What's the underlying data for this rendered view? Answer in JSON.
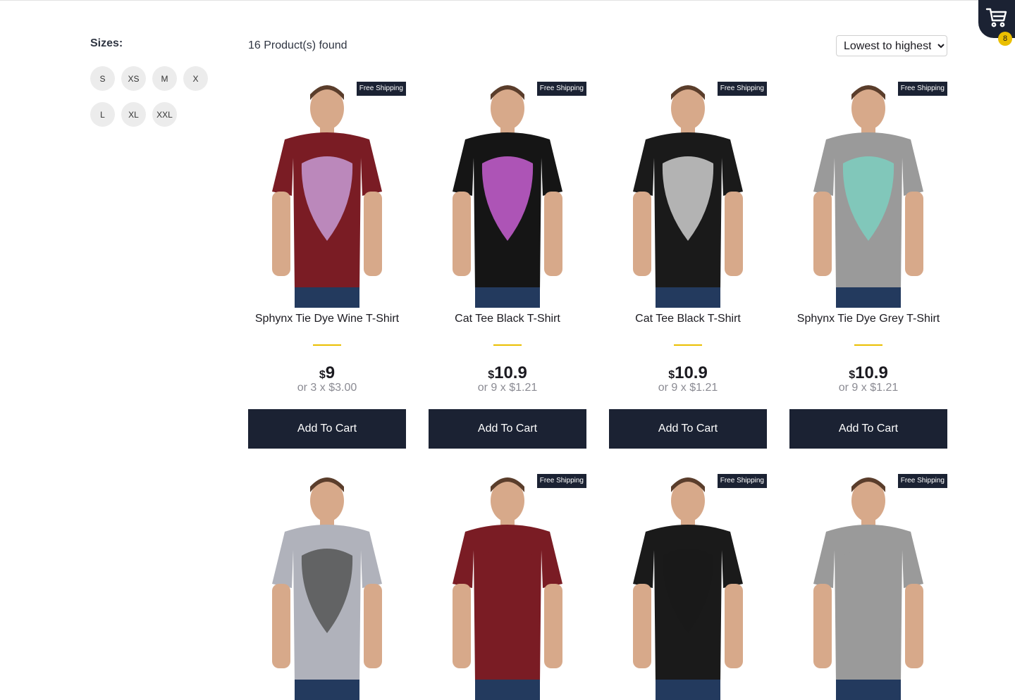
{
  "sidebar": {
    "title": "Sizes:",
    "sizes": [
      "S",
      "XS",
      "M",
      "X",
      "L",
      "XL",
      "XXL"
    ]
  },
  "header": {
    "found": "16 Product(s) found",
    "sort_selected": "Lowest to highest"
  },
  "cart": {
    "count": "8",
    "icon": "cart-icon"
  },
  "products": [
    {
      "title": "Sphynx Tie Dye Wine T-Shirt",
      "currency": "$",
      "price": "9",
      "installment": "or 3 x $3.00",
      "badge": "Free Shipping",
      "button": "Add To Cart",
      "shirt_color": "#7a1c24",
      "print_color": "#c79bd6"
    },
    {
      "title": "Cat Tee Black T-Shirt",
      "currency": "$",
      "price": "10.9",
      "installment": "or 9 x $1.21",
      "badge": "Free Shipping",
      "button": "Add To Cart",
      "shirt_color": "#151515",
      "print_color": "#c85fd2"
    },
    {
      "title": "Cat Tee Black T-Shirt",
      "currency": "$",
      "price": "10.9",
      "installment": "or 9 x $1.21",
      "badge": "Free Shipping",
      "button": "Add To Cart",
      "shirt_color": "#1a1a1a",
      "print_color": "#cfcfcf"
    },
    {
      "title": "Sphynx Tie Dye Grey T-Shirt",
      "currency": "$",
      "price": "10.9",
      "installment": "or 9 x $1.21",
      "badge": "Free Shipping",
      "button": "Add To Cart",
      "shirt_color": "#9a9a9a",
      "print_color": "#7dcfbf"
    },
    {
      "badge": "",
      "shirt_color": "#b0b2bb",
      "print_color": "#555"
    },
    {
      "badge": "Free Shipping",
      "shirt_color": "#7a1c24",
      "print_color": "#7a1c24"
    },
    {
      "badge": "Free Shipping",
      "shirt_color": "#1a1a1a",
      "print_color": "#1a1a1a"
    },
    {
      "badge": "Free Shipping",
      "shirt_color": "#9a9a9a",
      "print_color": "#9a9a9a"
    }
  ]
}
